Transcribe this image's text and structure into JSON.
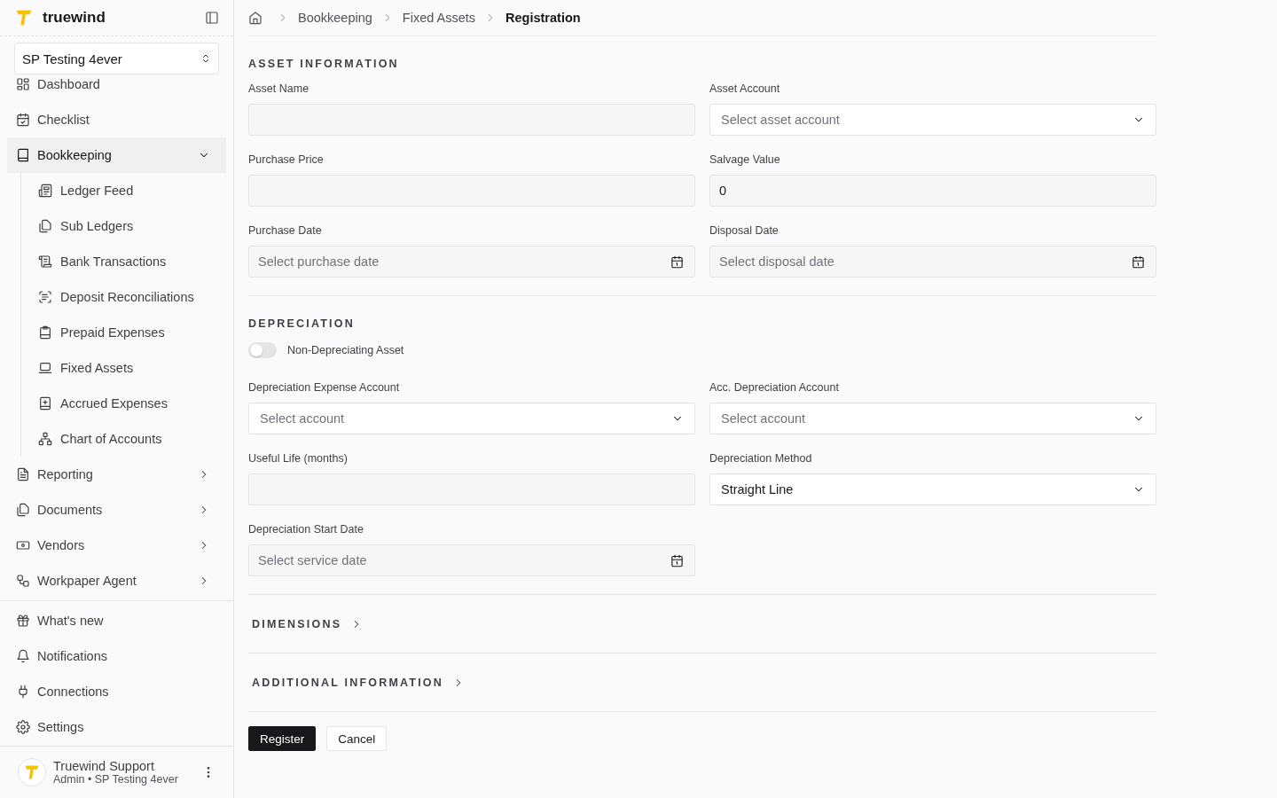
{
  "sidebar": {
    "brand": "truewind",
    "workspace": "SP Testing 4ever",
    "nav": [
      {
        "label": "Dashboard",
        "selected": false
      },
      {
        "label": "Checklist",
        "selected": false
      },
      {
        "label": "Bookkeeping",
        "selected": true,
        "expanded": true,
        "children": [
          {
            "label": "Ledger Feed"
          },
          {
            "label": "Sub Ledgers"
          },
          {
            "label": "Bank Transactions"
          },
          {
            "label": "Deposit Reconciliations"
          },
          {
            "label": "Prepaid Expenses"
          },
          {
            "label": "Fixed Assets"
          },
          {
            "label": "Accrued Expenses"
          },
          {
            "label": "Chart of Accounts"
          }
        ]
      },
      {
        "label": "Reporting",
        "selected": false,
        "expanded": false
      },
      {
        "label": "Documents",
        "selected": false,
        "expanded": false
      },
      {
        "label": "Vendors",
        "selected": false,
        "expanded": false
      },
      {
        "label": "Workpaper Agent",
        "selected": false,
        "expanded": false
      }
    ],
    "footer_nav": [
      {
        "label": "What's new"
      },
      {
        "label": "Notifications"
      },
      {
        "label": "Connections"
      },
      {
        "label": "Settings"
      }
    ],
    "user": {
      "name": "Truewind Support",
      "role": "Admin • SP Testing 4ever"
    }
  },
  "breadcrumb": [
    "Bookkeeping",
    "Fixed Assets",
    "Registration"
  ],
  "sections": [
    {
      "title": "ASSET INFORMATION",
      "fields": [
        {
          "kind": "text",
          "label": "Asset Name"
        },
        {
          "kind": "select",
          "label": "Asset Account",
          "placeholder": "Select asset account"
        },
        {
          "kind": "text",
          "label": "Purchase Price"
        },
        {
          "kind": "text",
          "label": "Salvage Value",
          "value": "0"
        },
        {
          "kind": "date",
          "label": "Purchase Date",
          "placeholder": "Select purchase date"
        },
        {
          "kind": "date",
          "label": "Disposal Date",
          "placeholder": "Select disposal date"
        }
      ]
    },
    {
      "title": "DEPRECIATION",
      "toggle": {
        "label": "Non-Depreciating Asset",
        "on": false
      },
      "fields": [
        {
          "kind": "select",
          "label": "Depreciation Expense Account",
          "placeholder": "Select account"
        },
        {
          "kind": "select",
          "label": "Acc. Depreciation Account",
          "placeholder": "Select account"
        },
        {
          "kind": "text",
          "label": "Useful Life (months)"
        },
        {
          "kind": "select",
          "label": "Depreciation Method",
          "value": "Straight Line"
        },
        {
          "kind": "date",
          "label": "Depreciation Start Date",
          "placeholder": "Select service date"
        }
      ]
    }
  ],
  "collapsibles": [
    {
      "title": "DIMENSIONS",
      "expanded": false
    },
    {
      "title": "ADDITIONAL INFORMATION",
      "expanded": false
    }
  ],
  "actions": [
    {
      "label": "Register",
      "kind": "primary"
    },
    {
      "label": "Cancel",
      "kind": "secondary"
    }
  ]
}
